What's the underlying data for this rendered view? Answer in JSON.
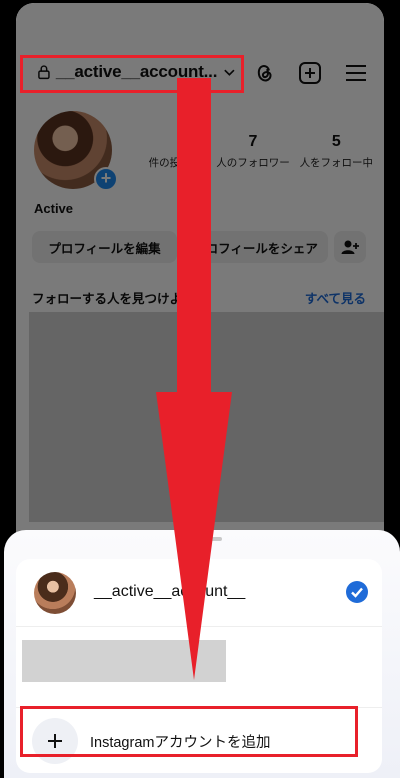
{
  "header": {
    "account_name": "__active__account...",
    "icons": [
      "lock-icon",
      "chevron-down-icon",
      "threads-icon",
      "new-post-icon",
      "menu-icon"
    ]
  },
  "profile": {
    "name": "Active",
    "stats": [
      {
        "value": "",
        "label": "件の投稿"
      },
      {
        "value": "7",
        "label": "人のフォロワー"
      },
      {
        "value": "5",
        "label": "人をフォロー中"
      }
    ],
    "edit_label": "プロフィールを編集",
    "share_label": "プロフィールをシェア"
  },
  "discover": {
    "label": "フォローする人を見つけよう",
    "see_all": "すべて見る"
  },
  "sheet": {
    "account_name": "__active__account__",
    "add_account_label": "Instagramアカウントを追加"
  },
  "colors": {
    "highlight": "#e8202a",
    "accent_blue": "#1f8bf0",
    "link_blue": "#1f6bd8"
  }
}
